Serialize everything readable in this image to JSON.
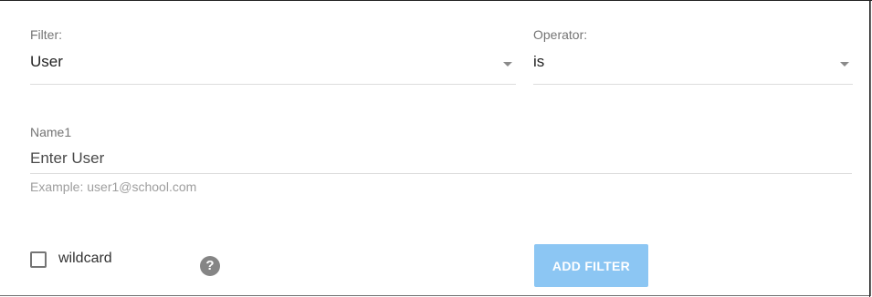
{
  "filter": {
    "label": "Filter:",
    "value": "User"
  },
  "operator": {
    "label": "Operator:",
    "value": "is"
  },
  "name": {
    "label": "Name1",
    "placeholder": "Enter User",
    "hint": "Example: user1@school.com"
  },
  "wildcard": {
    "label": "wildcard",
    "checked": false
  },
  "help": {
    "glyph": "?",
    "icon": "question-circle-icon"
  },
  "actions": {
    "add_filter_label": "ADD FILTER"
  },
  "colors": {
    "button_bg": "#8cc6f3",
    "label": "#757575",
    "hint": "#9e9e9e"
  }
}
